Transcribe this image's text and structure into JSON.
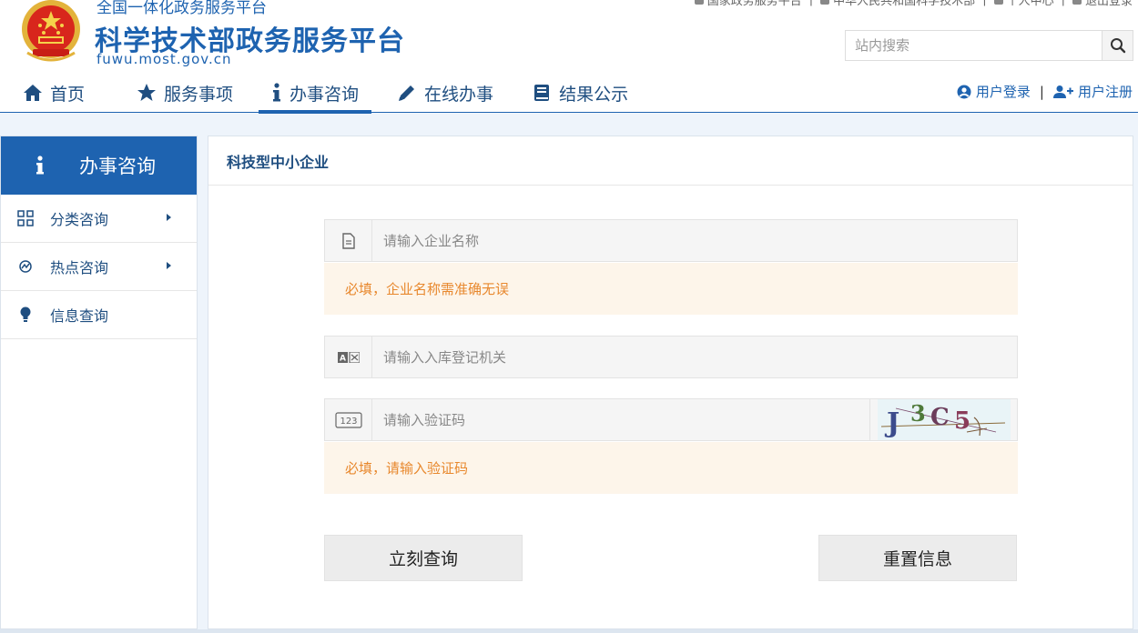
{
  "header": {
    "subtitle": "全国一体化政务服务平台",
    "title": "科学技术部政务服务平台",
    "url": "fuwu.most.gov.cn",
    "top_links": [
      "国家政务服务平台",
      "中华人民共和国科学技术部",
      "个人中心",
      "退出登录"
    ],
    "search": {
      "placeholder": "站内搜索"
    }
  },
  "nav": {
    "items": [
      {
        "label": "首页",
        "icon": "home-icon"
      },
      {
        "label": "服务事项",
        "icon": "star-icon"
      },
      {
        "label": "办事咨询",
        "icon": "info-icon",
        "active": true
      },
      {
        "label": "在线办事",
        "icon": "pencil-icon"
      },
      {
        "label": "结果公示",
        "icon": "book-icon"
      }
    ],
    "login": "用户登录",
    "register": "用户注册"
  },
  "sidebar": {
    "header": "办事咨询",
    "items": [
      {
        "label": "分类咨询",
        "icon": "grid-icon",
        "has_arrow": true
      },
      {
        "label": "热点咨询",
        "icon": "hotspot-icon",
        "has_arrow": true
      },
      {
        "label": "信息查询",
        "icon": "bulb-icon",
        "has_arrow": false
      }
    ]
  },
  "main": {
    "title": "科技型中小企业",
    "company_field": {
      "placeholder": "请输入企业名称"
    },
    "company_hint": "必填，企业名称需准确无误",
    "agency_field": {
      "placeholder": "请输入入库登记机关"
    },
    "captcha_field": {
      "placeholder": "请输入验证码",
      "captcha_text": "J3C5"
    },
    "captcha_hint": "必填，请输入验证码",
    "query_button": "立刻查询",
    "reset_button": "重置信息"
  },
  "colors": {
    "brand_blue": "#1e63b0",
    "hint_text": "#e8882d",
    "hint_bg": "#fdf5ea"
  }
}
